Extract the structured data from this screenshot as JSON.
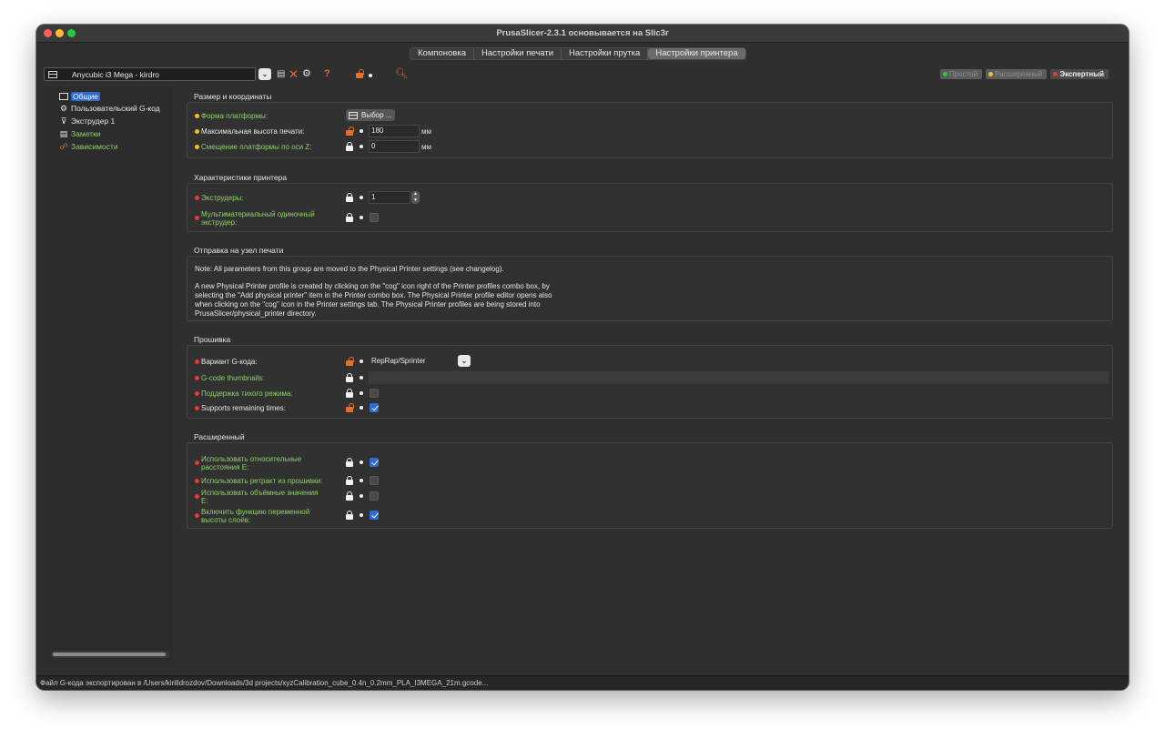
{
  "window": {
    "title": "PrusaSlicer-2.3.1 основывается на Slic3r"
  },
  "tabs": [
    {
      "label": "Компоновка"
    },
    {
      "label": "Настройки печати"
    },
    {
      "label": "Настройки прутка"
    },
    {
      "label": "Настройки принтера",
      "active": true
    }
  ],
  "toolbar": {
    "preset": "Anycubic i3 Mega - kirdro",
    "icons": [
      "preset-icon",
      "chevron-down-icon",
      "save-icon",
      "delete-icon",
      "cog-icon",
      "question-icon",
      "lock-open-icon",
      "search-icon"
    ]
  },
  "modes": [
    {
      "label": "Простой",
      "color": "#3cbf3c",
      "active": false
    },
    {
      "label": "Расширенный",
      "color": "#e8c330",
      "active": false
    },
    {
      "label": "Экспертный",
      "color": "#e03c3c",
      "active": true
    }
  ],
  "sidebar": {
    "items": [
      {
        "label": "Общие",
        "icon": "printer-icon"
      },
      {
        "label": "Пользовательский G-код",
        "icon": "cog-icon"
      },
      {
        "label": "Экструдер 1",
        "icon": "extruder-icon"
      },
      {
        "label": "Заметки",
        "icon": "notes-icon"
      },
      {
        "label": "Зависимости",
        "icon": "dependencies-icon"
      }
    ]
  },
  "sections": {
    "size": {
      "title": "Размер и координаты",
      "bed_shape": {
        "label": "Форма платформы:",
        "button": "Выбор ..."
      },
      "max_height": {
        "label": "Максимальная высота печати:",
        "value": "180",
        "unit": "мм"
      },
      "z_offset": {
        "label": "Смещение платформы по оси Z:",
        "value": "0",
        "unit": "мм"
      }
    },
    "printer": {
      "title": "Характеристики принтера",
      "extruders": {
        "label": "Экструдеры:",
        "value": "1"
      },
      "multimaterial": {
        "label_line1": "Мультиматериальный одиночный",
        "label_line2": "экструдер:",
        "checked": false
      }
    },
    "host": {
      "title": "Отправка на узел печати",
      "note1": "Note: All parameters from this group are moved to the Physical Printer settings (see changelog).",
      "note2": "A new Physical Printer profile is created by clicking on the \"cog\" icon right of the Printer profiles combo box, by\nselecting the \"Add physical printer\" item in the Printer combo box. The Physical Printer profile editor opens also\nwhen clicking on the \"cog\" icon in the Printer settings tab. The Physical Printer profiles are being stored into\nPrusaSlicer/physical_printer directory."
    },
    "firmware": {
      "title": "Прошивка",
      "gcode_flavor": {
        "label": "Вариант G-кода:",
        "value": "RepRap/Sprinter"
      },
      "thumbnails": {
        "label": "G-code thumbnails:",
        "value": ""
      },
      "silent_mode": {
        "label": "Поддержка тихого режима:",
        "checked": false
      },
      "remaining_times": {
        "label": "Supports remaining times:",
        "checked": true
      }
    },
    "advanced": {
      "title": "Расширенный",
      "relative_e": {
        "label_line1": "Использовать относительные",
        "label_line2": "расстояния E:",
        "checked": true
      },
      "fw_retract": {
        "label": "Использовать ретракт из прошивки:",
        "checked": false
      },
      "volumetric_e": {
        "label_line1": "Использовать объёмные значения",
        "label_line2": "E:",
        "checked": false
      },
      "variable_layer": {
        "label_line1": "Включить функцию переменной",
        "label_line2": "высоты слоёв:",
        "checked": true
      }
    }
  },
  "status": "Файл G-кода экспортирован в /Users/kirilldrozdov/Downloads/3d projects/xyzCalibration_cube_0.4n_0.2mm_PLA_I3MEGA_21m.gcode..."
}
